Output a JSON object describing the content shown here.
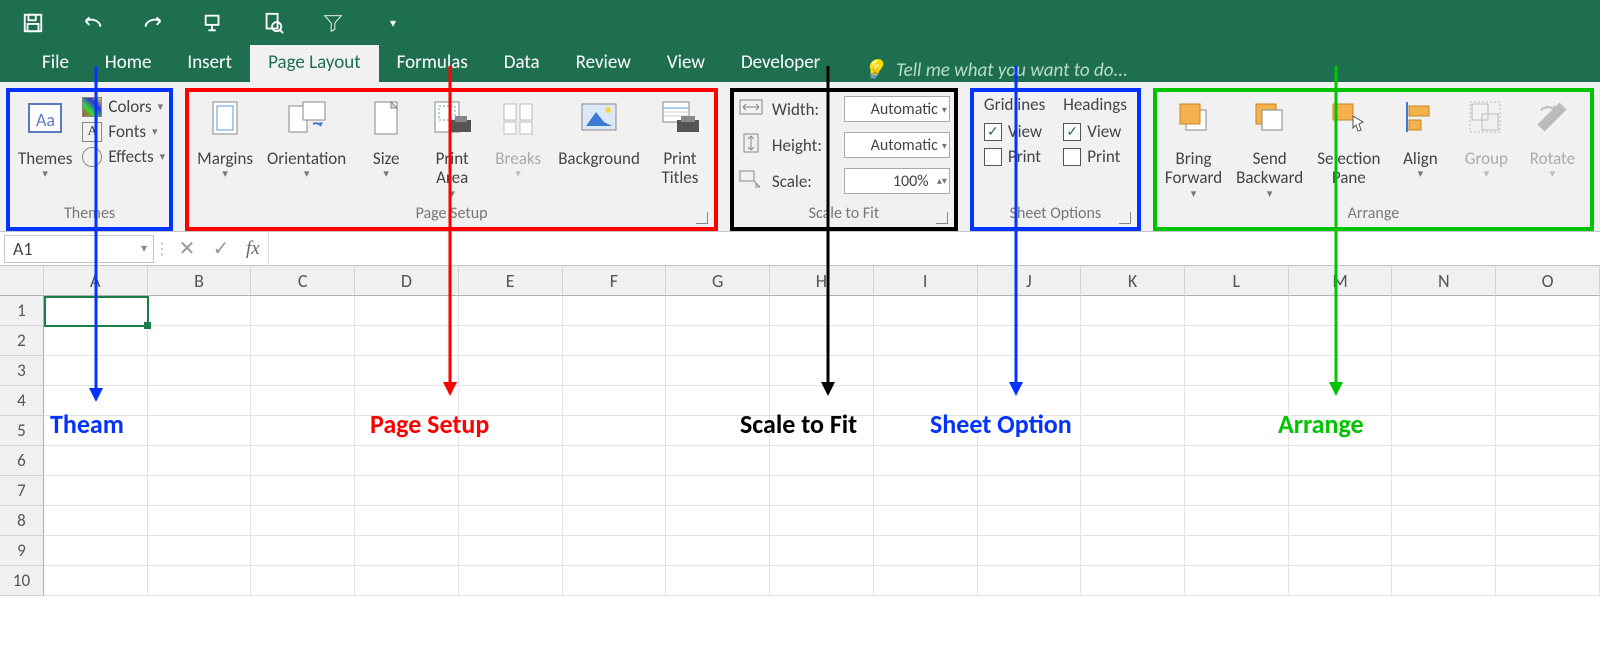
{
  "qat": {
    "icons": [
      "save",
      "undo",
      "redo",
      "touch-mode",
      "print-preview",
      "filter",
      "customize"
    ]
  },
  "tabs": {
    "items": [
      "File",
      "Home",
      "Insert",
      "Page Layout",
      "Formulas",
      "Data",
      "Review",
      "View",
      "Developer"
    ],
    "active_index": 3,
    "tell_me": "Tell me what you want to do..."
  },
  "ribbon": {
    "themes": {
      "label": "Themes",
      "themes_btn": "Themes",
      "colors": "Colors",
      "fonts": "Fonts",
      "effects": "Effects"
    },
    "page_setup": {
      "label": "Page Setup",
      "margins": "Margins",
      "orientation": "Orientation",
      "size": "Size",
      "print_area": "Print\nArea",
      "breaks": "Breaks",
      "background": "Background",
      "print_titles": "Print\nTitles"
    },
    "scale_to_fit": {
      "label": "Scale to Fit",
      "width_lbl": "Width:",
      "width_val": "Automatic",
      "height_lbl": "Height:",
      "height_val": "Automatic",
      "scale_lbl": "Scale:",
      "scale_val": "100%"
    },
    "sheet_options": {
      "label": "Sheet Options",
      "gridlines": "Gridlines",
      "headings": "Headings",
      "view": "View",
      "print": "Print",
      "gridlines_view": true,
      "gridlines_print": false,
      "headings_view": true,
      "headings_print": false
    },
    "arrange": {
      "label": "Arrange",
      "bring_forward": "Bring\nForward",
      "send_backward": "Send\nBackward",
      "selection_pane": "Selection\nPane",
      "align": "Align",
      "group": "Group",
      "rotate": "Rotate"
    }
  },
  "formula_bar": {
    "name_box": "A1",
    "fx": "fx"
  },
  "grid": {
    "columns": [
      "A",
      "B",
      "C",
      "D",
      "E",
      "F",
      "G",
      "H",
      "I",
      "J",
      "K",
      "L",
      "M",
      "N",
      "O"
    ],
    "row_count": 10,
    "active_cell": "A1"
  },
  "annotations": {
    "theme": {
      "text": "Theam",
      "color": "#0433ff"
    },
    "page": {
      "text": "Page Setup",
      "color": "#ff0000"
    },
    "scale": {
      "text": "Scale to Fit",
      "color": "#000000"
    },
    "sheet": {
      "text": "Sheet Option",
      "color": "#0433ff"
    },
    "arrange": {
      "text": "Arrange",
      "color": "#00c400"
    }
  }
}
